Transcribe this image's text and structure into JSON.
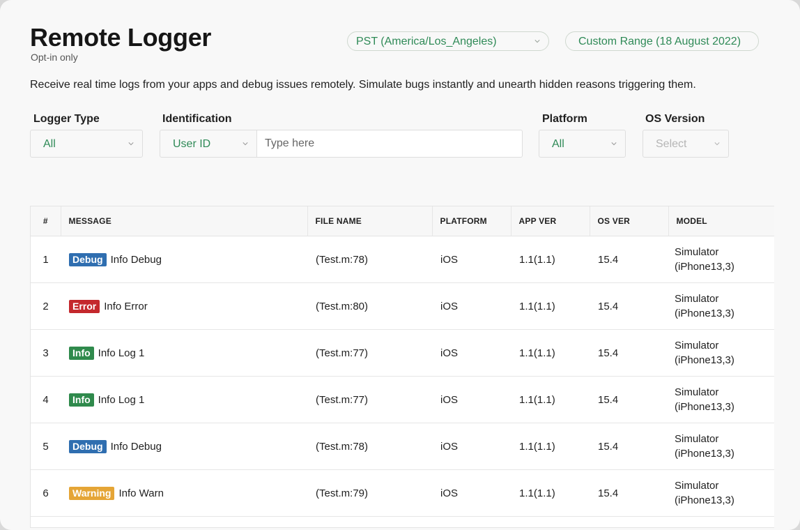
{
  "header": {
    "title": "Remote Logger",
    "subtitle": "Opt-in only",
    "timezone": "PST (America/Los_Angeles)",
    "date_range": "Custom Range (18 August 2022)",
    "description": "Receive real time logs from your apps and debug issues remotely. Simulate bugs instantly and unearth hidden reasons triggering them."
  },
  "filters": {
    "logger_type": {
      "label": "Logger Type",
      "value": "All"
    },
    "identification": {
      "label": "Identification",
      "type": "User ID",
      "placeholder": "Type here",
      "value": ""
    },
    "platform": {
      "label": "Platform",
      "value": "All"
    },
    "os_version": {
      "label": "OS Version",
      "value": "Select"
    }
  },
  "table": {
    "columns": [
      "#",
      "MESSAGE",
      "FILE NAME",
      "PLATFORM",
      "APP VER",
      "OS VER",
      "MODEL"
    ],
    "rows": [
      {
        "num": "1",
        "level": "Debug",
        "message": "Info Debug",
        "file": "(Test.m:78)",
        "platform": "iOS",
        "app_ver": "1.1(1.1)",
        "os_ver": "15.4",
        "model_line1": "Simulator",
        "model_line2": "(iPhone13,3)"
      },
      {
        "num": "2",
        "level": "Error",
        "message": "Info Error",
        "file": "(Test.m:80)",
        "platform": "iOS",
        "app_ver": "1.1(1.1)",
        "os_ver": "15.4",
        "model_line1": "Simulator",
        "model_line2": "(iPhone13,3)"
      },
      {
        "num": "3",
        "level": "Info",
        "message": "Info Log 1",
        "file": "(Test.m:77)",
        "platform": "iOS",
        "app_ver": "1.1(1.1)",
        "os_ver": "15.4",
        "model_line1": "Simulator",
        "model_line2": "(iPhone13,3)"
      },
      {
        "num": "4",
        "level": "Info",
        "message": "Info Log 1",
        "file": "(Test.m:77)",
        "platform": "iOS",
        "app_ver": "1.1(1.1)",
        "os_ver": "15.4",
        "model_line1": "Simulator",
        "model_line2": "(iPhone13,3)"
      },
      {
        "num": "5",
        "level": "Debug",
        "message": "Info Debug",
        "file": "(Test.m:78)",
        "platform": "iOS",
        "app_ver": "1.1(1.1)",
        "os_ver": "15.4",
        "model_line1": "Simulator",
        "model_line2": "(iPhone13,3)"
      },
      {
        "num": "6",
        "level": "Warning",
        "message": "Info Warn",
        "file": "(Test.m:79)",
        "platform": "iOS",
        "app_ver": "1.1(1.1)",
        "os_ver": "15.4",
        "model_line1": "Simulator",
        "model_line2": "(iPhone13,3)"
      }
    ]
  },
  "level_colors": {
    "Debug": "#2f6eb0",
    "Error": "#c4282d",
    "Info": "#2f8a4c",
    "Warning": "#e5a536"
  },
  "colors": {
    "accent_green": "#2f8a57",
    "background": "#f8f8f8"
  },
  "icons": {
    "dropdown": "chevron-down-icon"
  }
}
